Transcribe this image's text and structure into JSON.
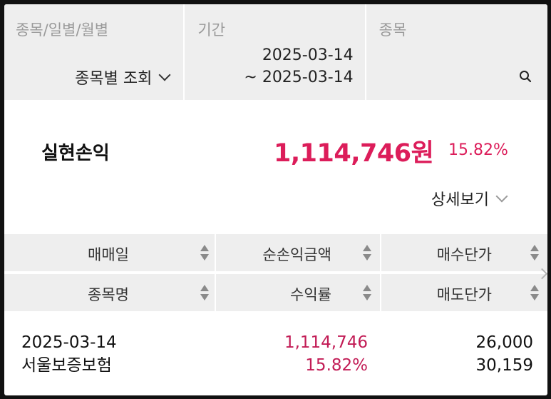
{
  "filters": {
    "type_label": "종목/일별/월별",
    "type_value": "종목별 조회",
    "period_label": "기간",
    "period_start": "2025-03-14",
    "period_end": "~ 2025-03-14",
    "stock_label": "종목"
  },
  "summary": {
    "label": "실현손익",
    "amount": "1,114,746원",
    "rate": "15.82%",
    "detail_toggle": "상세보기"
  },
  "table": {
    "headers_row1": [
      "매매일",
      "순손익금액",
      "매수단가"
    ],
    "headers_row2": [
      "종목명",
      "수익률",
      "매도단가"
    ],
    "rows": [
      {
        "date": "2025-03-14",
        "name": "서울보증보험",
        "net_profit": "1,114,746",
        "return_rate": "15.82%",
        "buy_price": "26,000",
        "sell_price": "30,159"
      }
    ]
  },
  "colors": {
    "accent": "#dc1d5a",
    "header_bg": "#eeeeee",
    "muted_text": "#9a9a9a"
  },
  "icons": [
    "chevron-down-icon",
    "search-icon",
    "sort-icon",
    "chevron-right-icon"
  ]
}
